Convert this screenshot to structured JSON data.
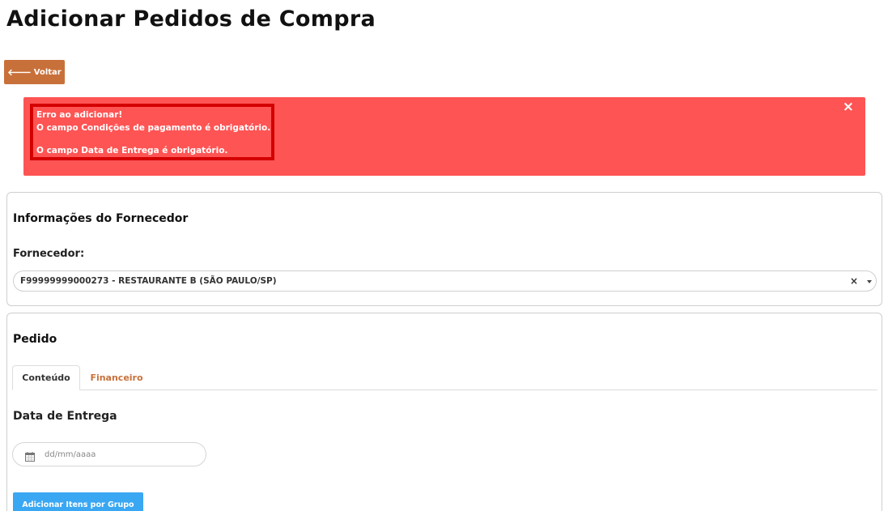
{
  "page": {
    "title": "Adicionar Pedidos de Compra"
  },
  "toolbar": {
    "back_label": "Voltar",
    "back_icon": "arrow-left-icon"
  },
  "alert": {
    "lines": [
      "Erro ao adicionar!",
      "O campo Condições de pagamento é obrigatório.",
      "O campo Data de Entrega é obrigatório."
    ],
    "close_symbol": "×",
    "color": "#ff5454",
    "highlight_color": "#d40000"
  },
  "supplier": {
    "section_title": "Informações do Fornecedor",
    "field_label": "Fornecedor:",
    "selected_value": "F99999999000273 - RESTAURANTE B (SÃO PAULO/SP)",
    "clear_symbol": "×"
  },
  "order": {
    "section_title": "Pedido",
    "tabs": [
      {
        "label": "Conteúdo",
        "active": true
      },
      {
        "label": "Financeiro",
        "active": false
      }
    ],
    "date_label": "Data de Entrega",
    "date_placeholder": "dd/mm/aaaa",
    "date_icon": "calendar-icon",
    "add_group_label": "Adicionar Itens por Grupo"
  },
  "colors": {
    "accent": "#c8703a",
    "primary_button": "#3aa7f3"
  }
}
